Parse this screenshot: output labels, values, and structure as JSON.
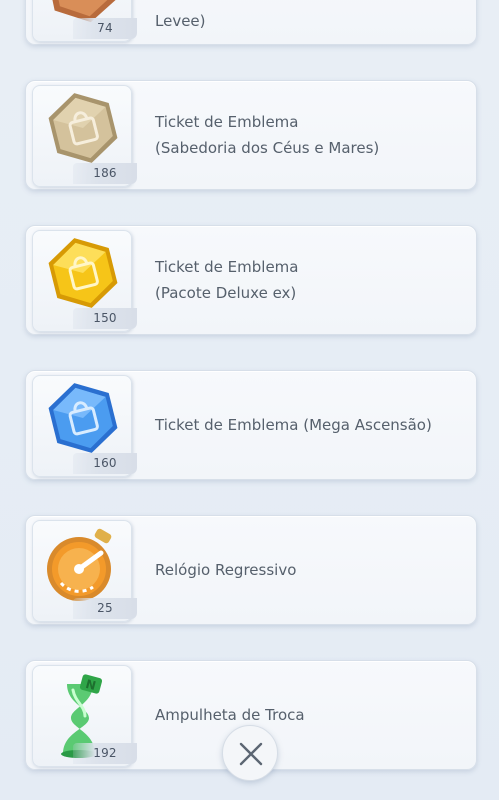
{
  "items": [
    {
      "title": "Levee)",
      "qty": "74",
      "icon": "emblem-ticket-bronze-icon"
    },
    {
      "title": "Ticket de Emblema\n(Sabedoria dos Céus e Mares)",
      "qty": "186",
      "icon": "emblem-ticket-beige-icon"
    },
    {
      "title": "Ticket de Emblema\n(Pacote Deluxe ex)",
      "qty": "150",
      "icon": "emblem-ticket-gold-icon"
    },
    {
      "title": "Ticket de Emblema (Mega Ascensão)",
      "qty": "160",
      "icon": "emblem-ticket-blue-icon"
    },
    {
      "title": "Relógio Regressivo",
      "qty": "25",
      "icon": "stopwatch-icon"
    },
    {
      "title": "Ampulheta de Troca",
      "qty": "192",
      "icon": "hourglass-icon"
    }
  ],
  "close_icon": "close-icon",
  "colors": {
    "bronze": "#c87a47",
    "beige": "#c9b48d",
    "gold": "#f2c012",
    "blue": "#3f8fe6",
    "orange": "#f08a1c",
    "green": "#3fc25a"
  }
}
